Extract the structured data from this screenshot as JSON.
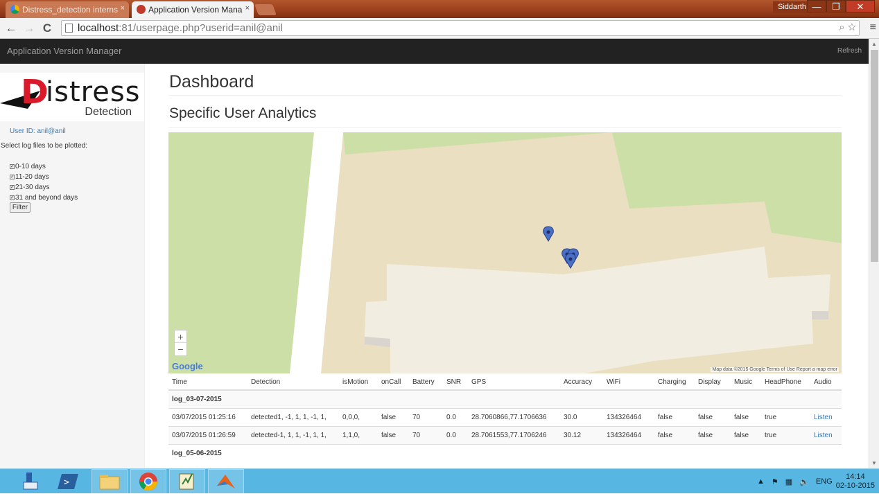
{
  "browser": {
    "tabs": [
      {
        "title": "Distress_detection interns",
        "active": false
      },
      {
        "title": "Application Version Mana",
        "active": true
      }
    ],
    "tab_close_label": "×",
    "user": "Siddarth",
    "window_buttons": {
      "minimize": "—",
      "restore": "❐",
      "close": "✕"
    },
    "url_host": "localhost",
    "url_rest": ":81/userpage.php?userid=anil@anil",
    "nav": {
      "back": "←",
      "forward": "→",
      "reload": "C"
    },
    "omnibox_icons": "⌕ ☆",
    "menu_icon": "≡"
  },
  "appbar": {
    "brand": "Application Version Manager",
    "refresh": "Refresh"
  },
  "sidebar": {
    "logo_letter": "D",
    "logo_word": "istress",
    "logo_sub": "Detection",
    "user_id": "User ID: anil@anil",
    "select_label": "Select log files to be plotted:",
    "filters": [
      {
        "label": "0-10 days",
        "checked": true
      },
      {
        "label": "11-20 days",
        "checked": true
      },
      {
        "label": "21-30 days",
        "checked": true
      },
      {
        "label": "31 and beyond days",
        "checked": true
      }
    ],
    "filter_button": "Filter"
  },
  "main": {
    "title": "Dashboard",
    "subtitle": "Specific User Analytics"
  },
  "map": {
    "zoom_in": "+",
    "zoom_out": "−",
    "logo": "Google",
    "credit": "Map data ©2015 Google   Terms of Use   Report a map error",
    "colors": {
      "park": "#cbdfa7",
      "area": "#eadfc1",
      "building": "#f2ede1",
      "road": "#ffffff",
      "marker": "#4a6fc4"
    }
  },
  "table": {
    "headers": [
      "Time",
      "Detection",
      "isMotion",
      "onCall",
      "Battery",
      "SNR",
      "GPS",
      "Accuracy",
      "WiFi",
      "Charging",
      "Display",
      "Music",
      "HeadPhone",
      "Audio"
    ],
    "groups": [
      {
        "name": "log_03-07-2015",
        "rows": [
          [
            "03/07/2015 01:25:16",
            "detected1, -1, 1, 1, -1, 1,",
            "0,0,0,",
            "false",
            "70",
            "0.0",
            "28.7060866,77.1706636",
            "30.0",
            "134326464",
            "false",
            "false",
            "false",
            "true",
            "Listen"
          ],
          [
            "03/07/2015 01:26:59",
            "detected-1, 1, 1, -1, 1, 1,",
            "1,1,0,",
            "false",
            "70",
            "0.0",
            "28.7061553,77.1706246",
            "30.12",
            "134326464",
            "false",
            "false",
            "false",
            "true",
            "Listen"
          ]
        ]
      },
      {
        "name": "log_05-06-2015",
        "rows": []
      }
    ]
  },
  "taskbar": {
    "tray_lang": "ENG",
    "time": "14:14",
    "date": "02-10-2015",
    "tray_arrow": "▲",
    "colors": {
      "bar": "#57b6e2"
    }
  }
}
